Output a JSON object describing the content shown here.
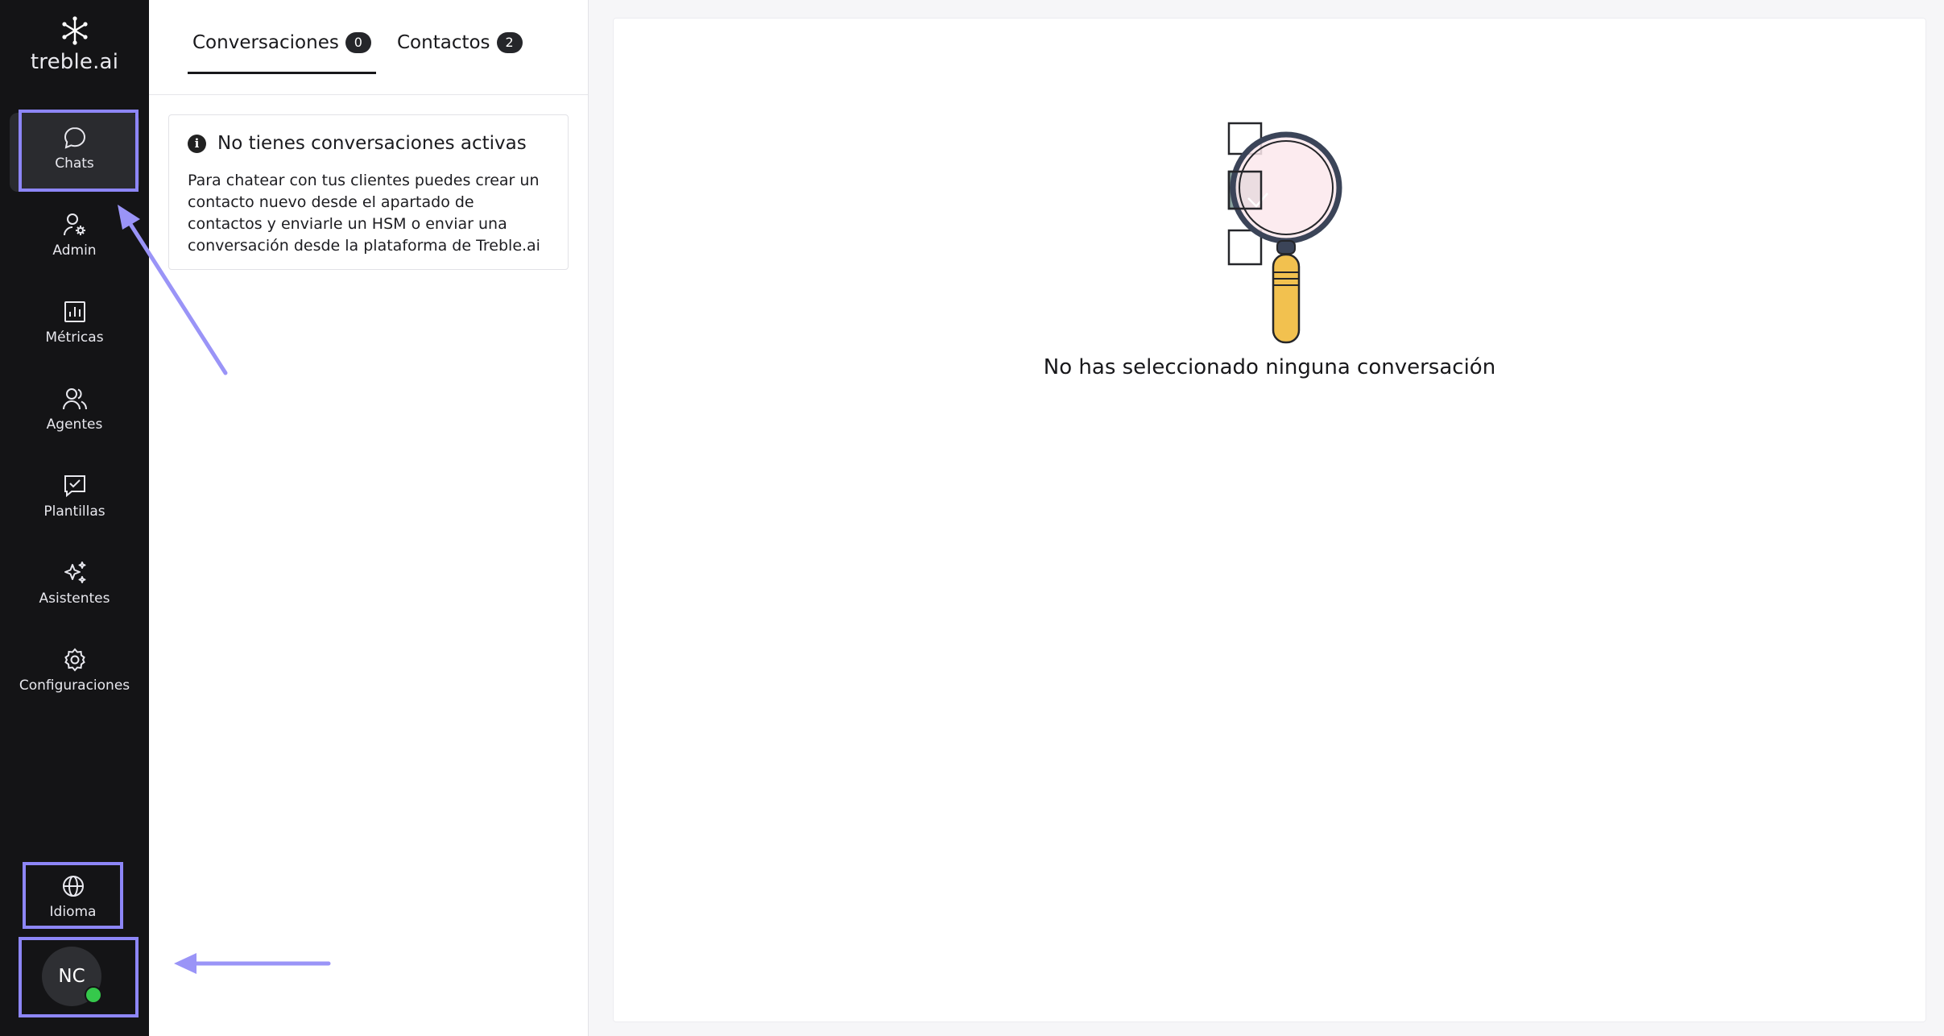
{
  "brand": {
    "name": "treble.ai"
  },
  "sidebar": {
    "items": [
      {
        "label": "Chats",
        "icon": "chat-bubble-icon",
        "active": true
      },
      {
        "label": "Admin",
        "icon": "user-settings-icon"
      },
      {
        "label": "Métricas",
        "icon": "bar-chart-icon"
      },
      {
        "label": "Agentes",
        "icon": "users-icon"
      },
      {
        "label": "Plantillas",
        "icon": "message-check-icon"
      },
      {
        "label": "Asistentes",
        "icon": "sparkles-icon"
      },
      {
        "label": "Configuraciones",
        "icon": "gear-icon"
      }
    ],
    "language": {
      "label": "Idioma",
      "icon": "globe-icon"
    },
    "user": {
      "initials": "NC",
      "status_color": "#35c84b"
    }
  },
  "tabs": [
    {
      "label": "Conversaciones",
      "count": "0",
      "active": true
    },
    {
      "label": "Contactos",
      "count": "2",
      "active": false
    }
  ],
  "notice": {
    "title": "No tienes conversaciones activas",
    "body": "Para chatear con tus clientes puedes crear un contacto nuevo desde el apartado de contactos y enviarle un HSM o enviar una conversación desde la plataforma de Treble.ai"
  },
  "main": {
    "empty_message": "No has seleccionado ninguna conversación",
    "illustration": "magnifying-glass-checklist-illustration"
  },
  "colors": {
    "sidebar_bg": "#141416",
    "highlight": "#8d86f7",
    "online": "#35c84b"
  }
}
